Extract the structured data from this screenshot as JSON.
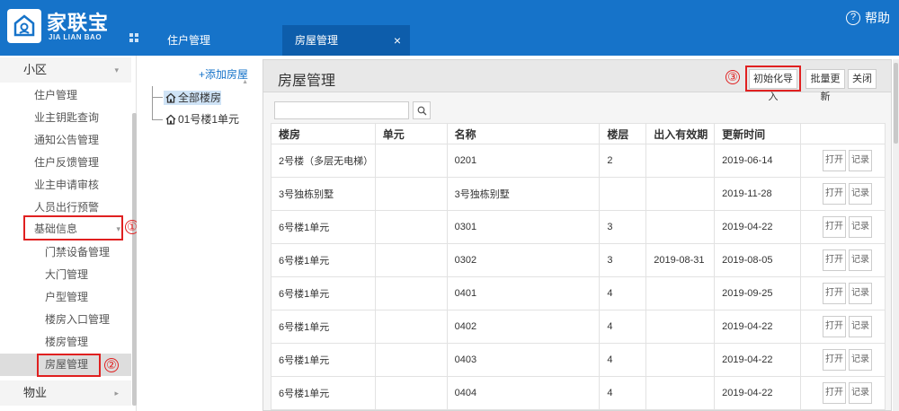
{
  "app": {
    "name": "家联宝",
    "subtitle": "JIA LIAN BAO",
    "help_label": "帮助"
  },
  "tabs": [
    {
      "label": "住户管理"
    },
    {
      "label": "房屋管理",
      "close": "×"
    }
  ],
  "sidebar": {
    "group1": "小区",
    "items": [
      {
        "label": "住户管理"
      },
      {
        "label": "业主钥匙查询"
      },
      {
        "label": "通知公告管理"
      },
      {
        "label": "住户反馈管理"
      },
      {
        "label": "业主申请审核"
      },
      {
        "label": "人员出行预警"
      },
      {
        "label": "基础信息"
      }
    ],
    "subitems": [
      {
        "label": "门禁设备管理"
      },
      {
        "label": "大门管理"
      },
      {
        "label": "户型管理"
      },
      {
        "label": "楼房入口管理"
      },
      {
        "label": "楼房管理"
      },
      {
        "label": "房屋管理"
      }
    ],
    "group2": "物业",
    "markers": [
      "①",
      "②",
      "③"
    ]
  },
  "tree": {
    "add_label": "+添加房屋",
    "nodes": [
      {
        "label": "全部楼房"
      },
      {
        "label": "01号楼1单元"
      }
    ]
  },
  "main": {
    "title": "房屋管理",
    "buttons": {
      "init_import": "初始化导入",
      "batch_update": "批量更新",
      "close": "关闭"
    },
    "search": {
      "value": ""
    },
    "table": {
      "headers": [
        "楼房",
        "单元",
        "名称",
        "楼层",
        "出入有效期",
        "更新时间",
        ""
      ],
      "action_open": "打开",
      "action_log": "记录",
      "rows": [
        [
          "2号楼（多层无电梯）",
          "",
          "0201",
          "2",
          "",
          "2019-06-14"
        ],
        [
          "3号独栋别墅",
          "",
          "3号独栋别墅",
          "",
          "",
          "2019-11-28"
        ],
        [
          "6号楼1单元",
          "",
          "0301",
          "3",
          "",
          "2019-04-22"
        ],
        [
          "6号楼1单元",
          "",
          "0302",
          "3",
          "2019-08-31",
          "2019-08-05"
        ],
        [
          "6号楼1单元",
          "",
          "0401",
          "4",
          "",
          "2019-09-25"
        ],
        [
          "6号楼1单元",
          "",
          "0402",
          "4",
          "",
          "2019-04-22"
        ],
        [
          "6号楼1单元",
          "",
          "0403",
          "4",
          "",
          "2019-04-22"
        ],
        [
          "6号楼1单元",
          "",
          "0404",
          "4",
          "",
          "2019-04-22"
        ]
      ]
    }
  },
  "colors": {
    "brand": "#1673c9",
    "active_tab": "#0d5dab",
    "annotation": "#e02020"
  }
}
